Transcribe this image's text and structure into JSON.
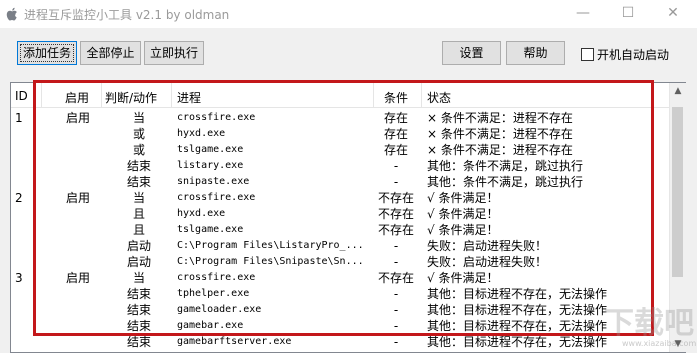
{
  "window": {
    "title": "进程互斥监控小工具 v2.1 by oldman",
    "minimize_glyph": "—",
    "maximize_glyph": "☐",
    "close_glyph": "✕"
  },
  "toolbar": {
    "add_task": "添加任务",
    "stop_all": "全部停止",
    "run_now": "立即执行",
    "settings": "设置",
    "help": "帮助",
    "autostart_label": "开机自动启动",
    "autostart_checked": false
  },
  "table": {
    "headers": {
      "id": "ID",
      "enabled": "启用",
      "action": "判断/动作",
      "process": "进程",
      "condition": "条件",
      "status": "状态"
    },
    "rows": [
      {
        "id": "1",
        "enabled": "启用",
        "action": "当",
        "process": "crossfire.exe",
        "condition": "存在",
        "status": "× 条件不满足：进程不存在"
      },
      {
        "id": "",
        "enabled": "",
        "action": "或",
        "process": "hyxd.exe",
        "condition": "存在",
        "status": "× 条件不满足：进程不存在"
      },
      {
        "id": "",
        "enabled": "",
        "action": "或",
        "process": "tslgame.exe",
        "condition": "存在",
        "status": "× 条件不满足：进程不存在"
      },
      {
        "id": "",
        "enabled": "",
        "action": "结束",
        "process": "listary.exe",
        "condition": "-",
        "status": "其他：条件不满足，跳过执行"
      },
      {
        "id": "",
        "enabled": "",
        "action": "结束",
        "process": "snipaste.exe",
        "condition": "-",
        "status": "其他：条件不满足，跳过执行"
      },
      {
        "id": "2",
        "enabled": "启用",
        "action": "当",
        "process": "crossfire.exe",
        "condition": "不存在",
        "status": "√ 条件满足！"
      },
      {
        "id": "",
        "enabled": "",
        "action": "且",
        "process": "hyxd.exe",
        "condition": "不存在",
        "status": "√ 条件满足！"
      },
      {
        "id": "",
        "enabled": "",
        "action": "且",
        "process": "tslgame.exe",
        "condition": "不存在",
        "status": "√ 条件满足！"
      },
      {
        "id": "",
        "enabled": "",
        "action": "启动",
        "process": "C:\\Program Files\\ListaryPro_...",
        "condition": "-",
        "status": "失败：启动进程失败！"
      },
      {
        "id": "",
        "enabled": "",
        "action": "启动",
        "process": "C:\\Program Files\\Snipaste\\Sn...",
        "condition": "-",
        "status": "失败：启动进程失败！"
      },
      {
        "id": "3",
        "enabled": "启用",
        "action": "当",
        "process": "crossfire.exe",
        "condition": "不存在",
        "status": "√ 条件满足！"
      },
      {
        "id": "",
        "enabled": "",
        "action": "结束",
        "process": "tphelper.exe",
        "condition": "-",
        "status": "其他：目标进程不存在，无法操作"
      },
      {
        "id": "",
        "enabled": "",
        "action": "结束",
        "process": "gameloader.exe",
        "condition": "-",
        "status": "其他：目标进程不存在，无法操作"
      },
      {
        "id": "",
        "enabled": "",
        "action": "结束",
        "process": "gamebar.exe",
        "condition": "-",
        "status": "其他：目标进程不存在，无法操作"
      },
      {
        "id": "",
        "enabled": "",
        "action": "结束",
        "process": "gamebarftserver.exe",
        "condition": "-",
        "status": "其他：目标进程不存在，无法操作"
      }
    ]
  },
  "watermark": {
    "text": "下载吧",
    "url": "www.xiazaiba.com"
  },
  "colors": {
    "highlight_frame": "#c3171a",
    "title_text": "#9a9a9a"
  }
}
